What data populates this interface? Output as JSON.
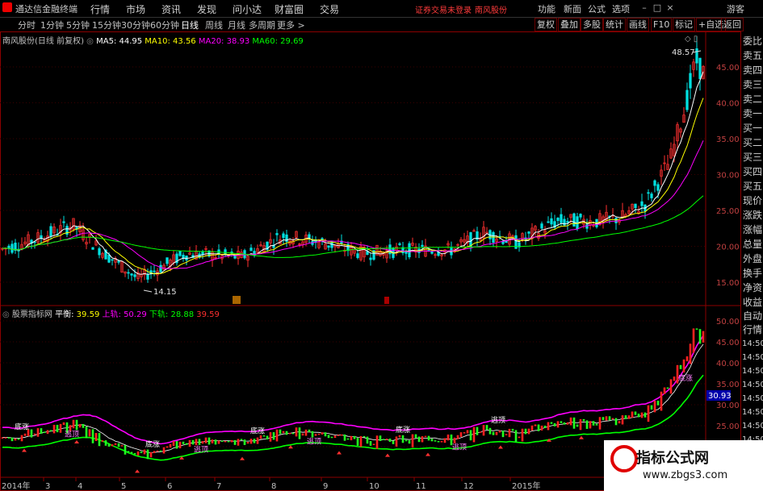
{
  "app": {
    "title": "通达信金融终端"
  },
  "menu": [
    "行情",
    "市场",
    "资讯",
    "发现",
    "问小达",
    "财富圈",
    "交易"
  ],
  "notice": {
    "broker": "证券交易未登录",
    "stock": "南风股份"
  },
  "right_menu": [
    "功能",
    "新面",
    "公式",
    "选项"
  ],
  "user": "游客",
  "periods": [
    "分时",
    "1分钟",
    "5分钟",
    "15分钟",
    "30分钟",
    "60分钟",
    "日线",
    "周线",
    "月线",
    "多周期",
    "更多 >"
  ],
  "active_period": "日线",
  "toolbar_buttons": [
    "复权",
    "叠加",
    "多股",
    "统计",
    "画线",
    "F10",
    "标记",
    "+自选",
    "返回"
  ],
  "main_legend": {
    "title": "南风股份(日线 前复权)",
    "ma5": "MA5: 44.95",
    "ma10": "MA10: 43.56",
    "ma20": "MA20: 38.93",
    "ma60": "MA60: 29.69"
  },
  "main_axis": [
    "45.00",
    "40.00",
    "35.00",
    "30.00",
    "25.00",
    "20.00",
    "15.00"
  ],
  "price_high": "48.57",
  "price_low": "14.15",
  "sub_legend": {
    "title": "股票指标网",
    "ping_label": "平衡:",
    "ping_val": "39.59",
    "upper_label": "上轨:",
    "upper_val": "50.29",
    "lower_label": "下轨:",
    "lower_val": "28.88",
    "extra": "39.59"
  },
  "sub_axis": [
    "50.00",
    "45.00",
    "40.00",
    "35.00",
    "30.00",
    "25.00",
    "20.00"
  ],
  "sub_current": "30.93",
  "right_side_labels": [
    "委比",
    "卖五",
    "卖四",
    "卖三",
    "卖二",
    "卖一",
    "买一",
    "买二",
    "买三",
    "买四",
    "买五",
    "现价",
    "涨跌",
    "涨幅",
    "总量",
    "外盘",
    "换手",
    "净资",
    "收益"
  ],
  "right_side_lower": [
    "自动",
    "行情",
    "14:50",
    "14:50",
    "14:50",
    "14:50",
    "14:50",
    "14:50",
    "14:50",
    "14:50"
  ],
  "date_axis": [
    "2014年",
    "3",
    "4",
    "5",
    "6",
    "7",
    "8",
    "9",
    "10",
    "11",
    "12",
    "2015年"
  ],
  "signals": [
    "底涨",
    "逃顶",
    "底涨",
    "逃顶",
    "底涨",
    "逃顶",
    "底涨",
    "逃顶",
    "逃顶",
    "底涨"
  ],
  "watermark": {
    "title": "指标公式网",
    "url": "www.zbgs3.com"
  },
  "colors": {
    "up": "#ff3030",
    "down": "#00e0e0",
    "ma5": "#ffffff",
    "ma10": "#ffff00",
    "ma20": "#ff00ff",
    "ma60": "#00ff00",
    "frame": "#8b0000"
  }
}
